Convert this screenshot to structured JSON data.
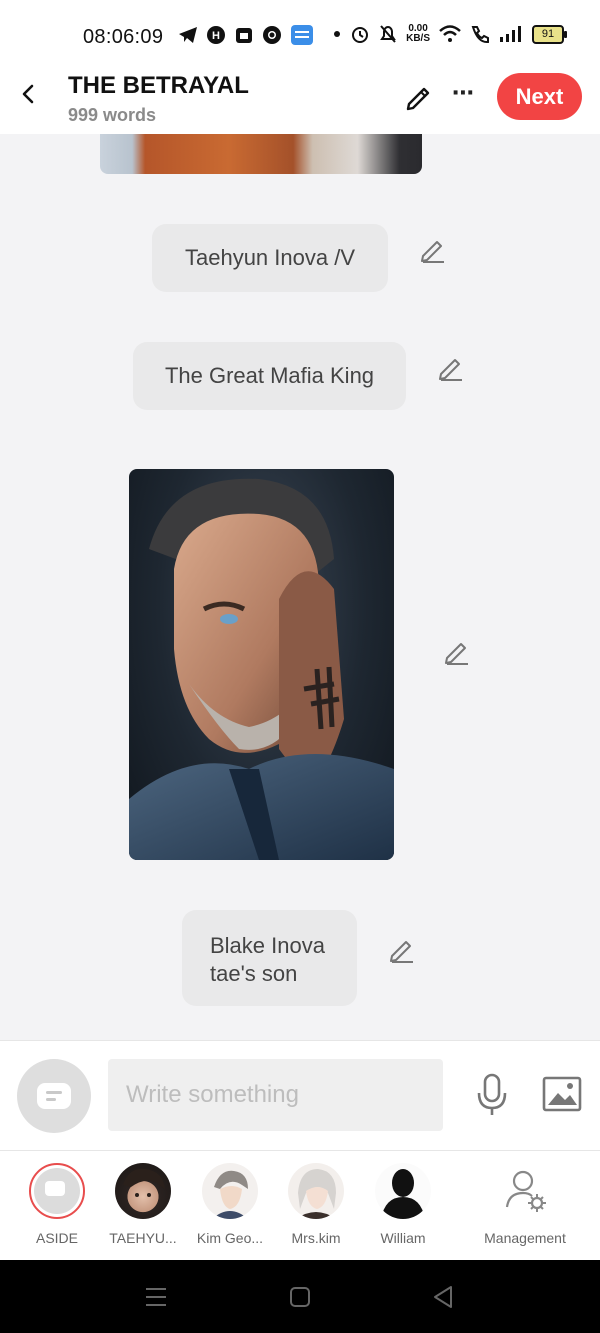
{
  "status_bar": {
    "time": "08:06:09",
    "network_speed_value": "0.00",
    "network_speed_unit": "KB/S",
    "battery": "91"
  },
  "header": {
    "title": "THE BETRAYAL",
    "word_count": "999 words",
    "next_label": "Next"
  },
  "messages": [
    {
      "type": "text",
      "text": "Taehyun Inova /V"
    },
    {
      "type": "text",
      "text": "The Great Mafia King"
    },
    {
      "type": "image",
      "icon": "portrait-image"
    },
    {
      "type": "text",
      "text": "Blake Inova\ntae's son"
    }
  ],
  "input": {
    "placeholder": "Write something"
  },
  "characters": [
    {
      "name": "ASIDE",
      "icon": "aside-icon",
      "selected": true
    },
    {
      "name": "TAEHYU...",
      "icon": "avatar"
    },
    {
      "name": "Kim Geo...",
      "icon": "avatar"
    },
    {
      "name": "Mrs.kim",
      "icon": "avatar"
    },
    {
      "name": "William",
      "icon": "avatar"
    },
    {
      "name": "Management",
      "icon": "management-icon"
    }
  ],
  "colors": {
    "accent": "#f24444",
    "bubble": "#e9e9ea",
    "background": "#f3f3f5"
  }
}
